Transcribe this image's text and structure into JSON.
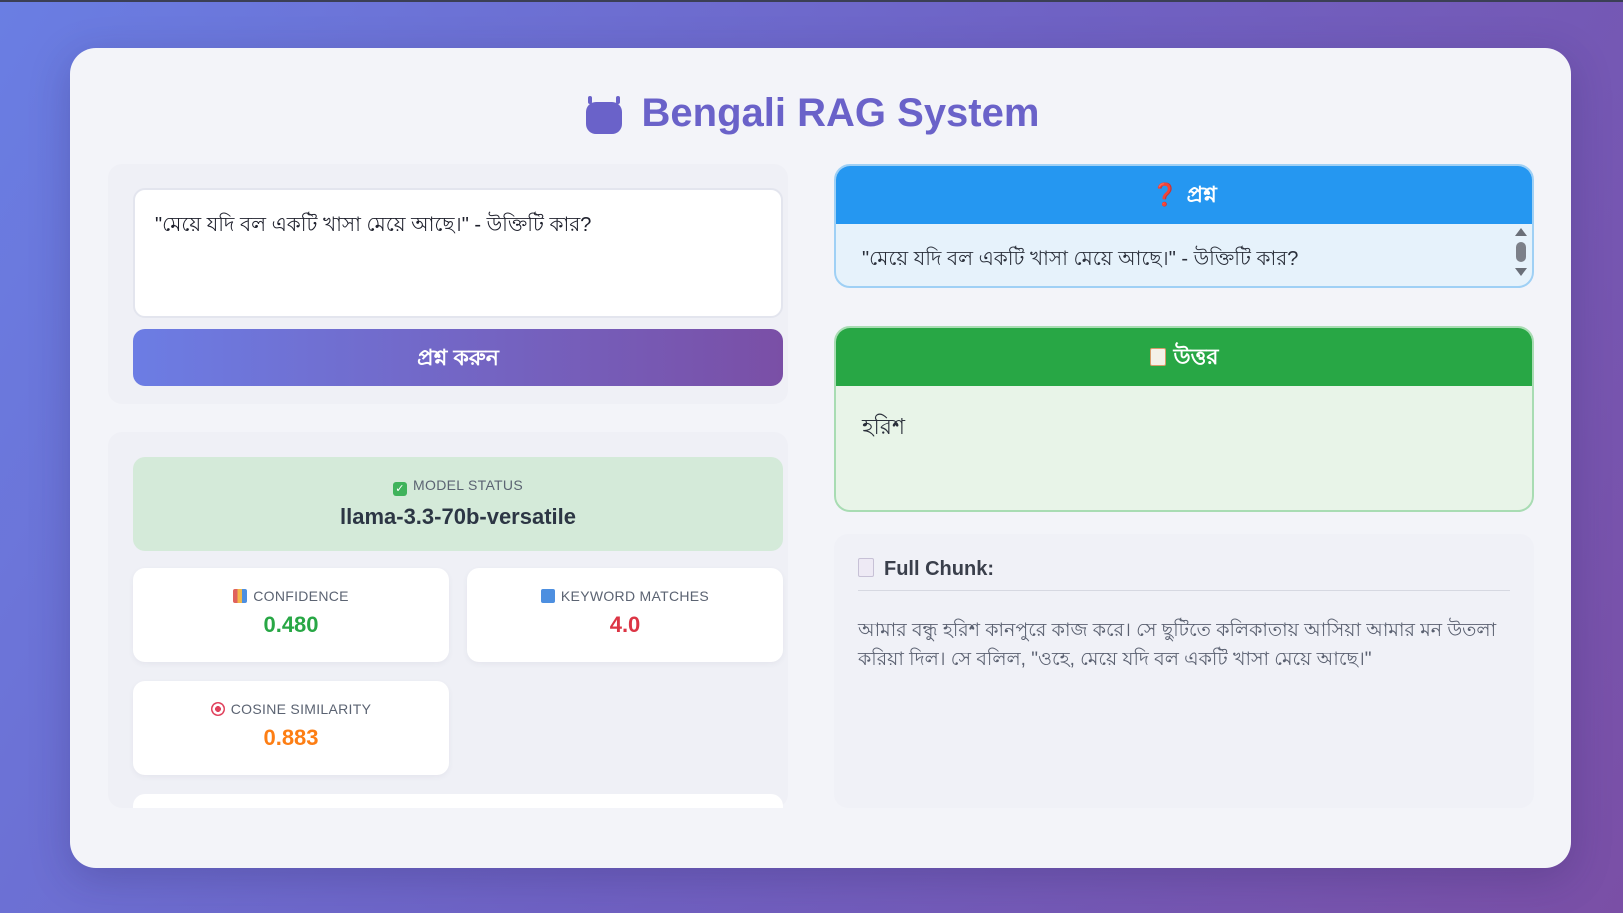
{
  "app": {
    "title": "Bengali RAG System",
    "title_icon": "robot-icon"
  },
  "query": {
    "input_value": "\"মেয়ে যদি বল একটি খাসা মেয়ে আছে।\" - উক্তিটি কার?",
    "submit_label": "প্রশ্ন করুন"
  },
  "metrics": {
    "model_status": {
      "icon": "check-icon",
      "label": "MODEL STATUS",
      "value": "llama-3.3-70b-versatile"
    },
    "confidence": {
      "icon": "bar-chart-icon",
      "label": "CONFIDENCE",
      "value": "0.480",
      "color": "#28a745"
    },
    "keyword_matches": {
      "icon": "numbers-icon",
      "label": "KEYWORD MATCHES",
      "value": "4.0",
      "color": "#dc3545"
    },
    "cosine_similarity": {
      "icon": "target-icon",
      "label": "COSINE SIMILARITY",
      "value": "0.883",
      "color": "#fd7e14"
    }
  },
  "question_panel": {
    "icon": "question-icon",
    "header": "প্রশ্ন",
    "text": "\"মেয়ে যদি বল একটি খাসা মেয়ে আছে।\" - উক্তিটি কার?",
    "color": "#2597f1"
  },
  "answer_panel": {
    "icon": "memo-icon",
    "header": "উত্তর",
    "text": "হরিশ",
    "color": "#28a745"
  },
  "chunk": {
    "icon": "document-icon",
    "header": "Full Chunk:",
    "text": "আমার বন্ধু হরিশ কানপুরে কাজ করে। সে ছুটিতে কলিকাতায় আসিয়া আমার মন উতলা করিয়া দিল। সে বলিল, \"ওহে, মেয়ে যদি বল একটি খাসা মেয়ে আছে।\""
  }
}
